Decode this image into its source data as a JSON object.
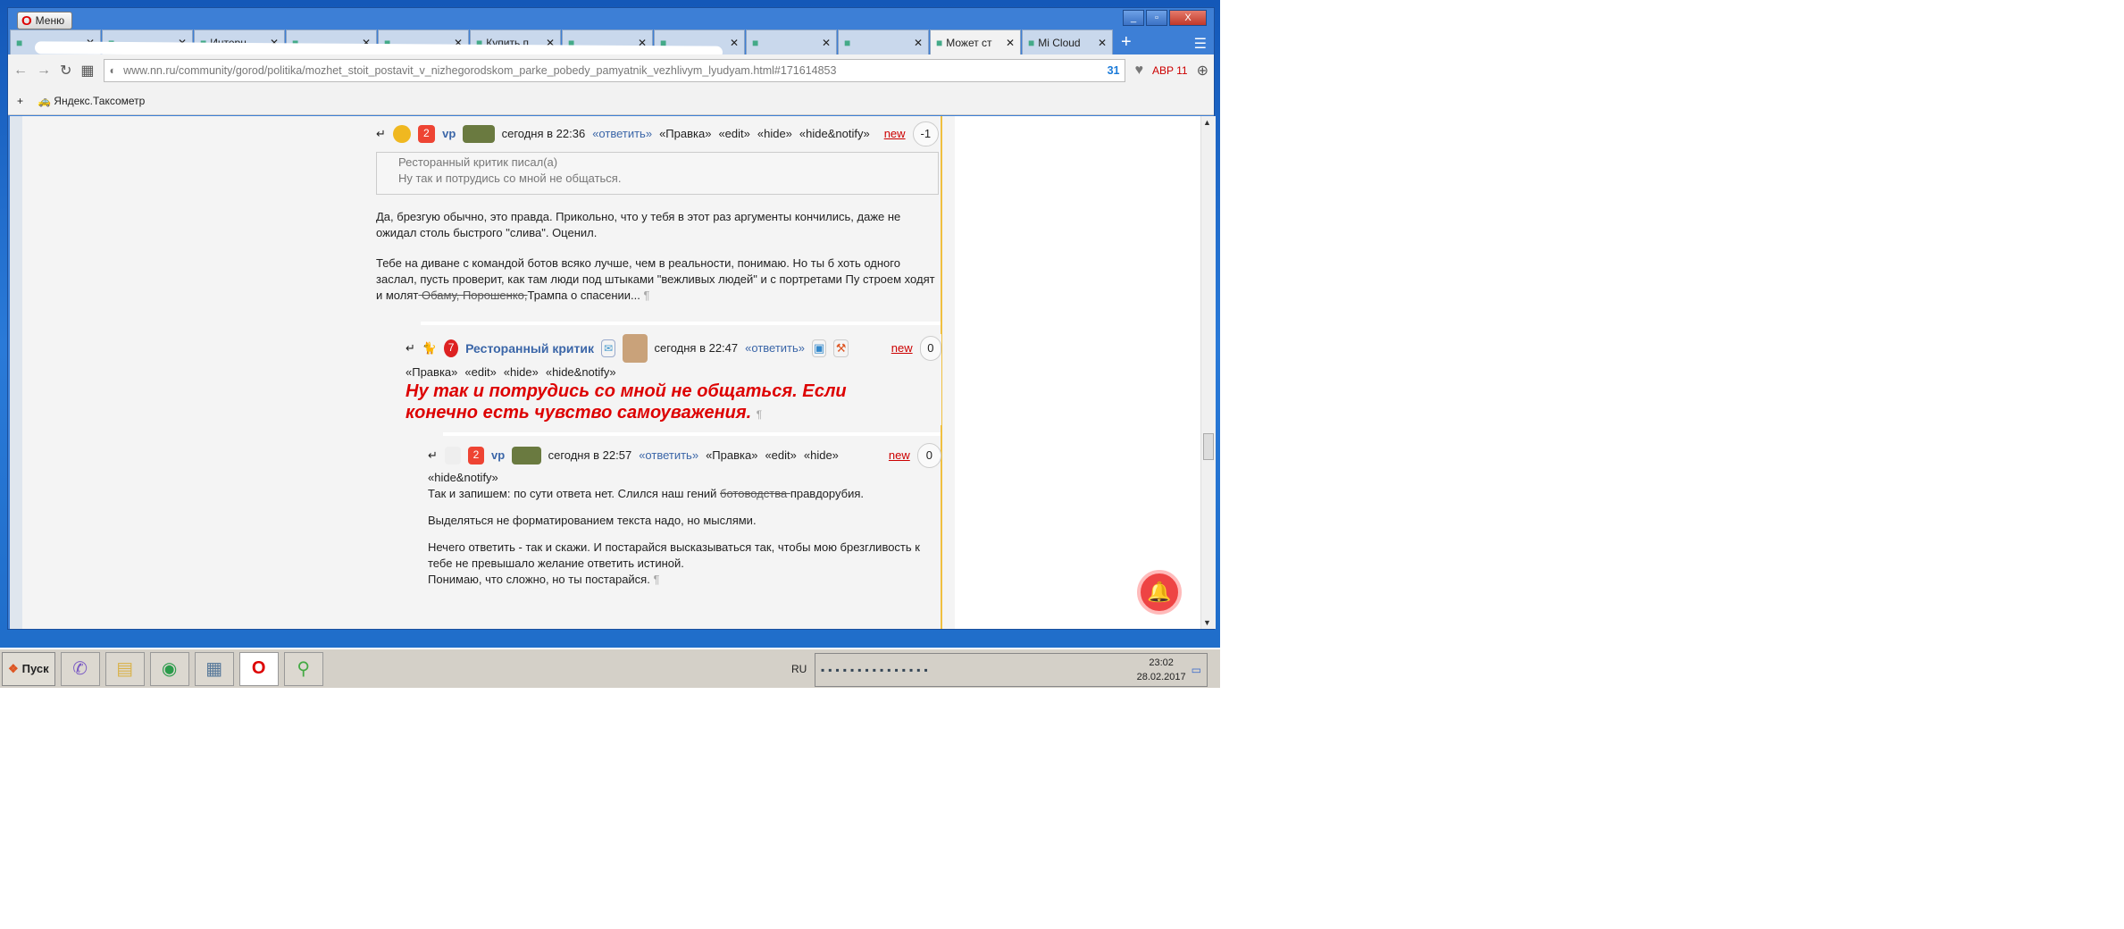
{
  "browser": {
    "menu_label": "Меню",
    "tabs": [
      {
        "label": ""
      },
      {
        "label": ""
      },
      {
        "label": "Интерн"
      },
      {
        "label": ""
      },
      {
        "label": ""
      },
      {
        "label": "Купить п"
      },
      {
        "label": ""
      },
      {
        "label": ""
      },
      {
        "label": ""
      },
      {
        "label": ""
      },
      {
        "label": "Может ст",
        "active": true
      },
      {
        "label": "Mi Cloud"
      }
    ],
    "url": "www.nn.ru/community/gorod/politika/mozhet_stoit_postavit_v_nizhegorodskom_parke_pobedy_pamyatnik_vezhlivym_lyudyam.html#171614853",
    "url_host": "nn.ru",
    "badge_count": "31",
    "abp_count": "11",
    "bookmark": "Яндекс.Таксометр"
  },
  "comments": [
    {
      "user": "vp",
      "rank": "2",
      "time": "сегодня в 22:36",
      "reply": "«ответить»",
      "actions": [
        "«Правка»",
        "«edit»",
        "«hide»",
        "«hide&notify»"
      ],
      "new": "new",
      "rating": "-1",
      "quote": {
        "author": "Ресторанный критик писал(а)",
        "text": "Ну так и потрудись со мной не общаться."
      },
      "p1": "Да, брезгую обычно, это правда. Прикольно, что у тебя в этот раз аргументы кончились, даже не ожидал столь быстрого \"слива\". Оценил.",
      "p2a": "Тебе на диване с командой ботов всяко лучше, чем в реальности, понимаю. Но ты б хоть одного заслал, пусть проверит, как там люди под штыками \"вежливых людей\" и с портретами Пу строем ходят и молят",
      "p2s": " Обаму, Порошенко,",
      "p2b": "Трампа о спасении... "
    },
    {
      "user": "Ресторанный критик",
      "rank": "7",
      "time": "сегодня в 22:47",
      "reply": "«ответить»",
      "actions": [
        "«Правка»",
        "«edit»",
        "«hide»",
        "«hide&notify»"
      ],
      "new": "new",
      "rating": "0",
      "text": "Ну так и потрудись со мной не общаться. Если конечно есть чувство самоуважения."
    },
    {
      "user": "vp",
      "rank": "2",
      "time": "сегодня в 22:57",
      "reply": "«ответить»",
      "actions": [
        "«Правка»",
        "«edit»",
        "«hide»",
        "«hide&notify»"
      ],
      "new": "new",
      "rating": "0",
      "p1a": "Так и запишем: по сути ответа нет. Слился наш гений ",
      "p1s": "ботоводства ",
      "p1b": "правдорубия.",
      "p2": "Выделяться не форматированием текста надо, но мыслями.",
      "p3": "Нечего ответить - так и скажи. И постарайся высказываться так, чтобы мою брезгливость к тебе не превышало желание ответить истиной.",
      "p4": "Понимаю, что сложно, но ты постарайся. "
    }
  ],
  "pilcrow": "¶",
  "taskbar": {
    "start": "Пуск",
    "lang": "RU",
    "time": "23:02",
    "date": "28.02.2017"
  },
  "colors": {
    "accent": "#3b66a8",
    "red": "#dd0000",
    "new": "#cc0000"
  }
}
